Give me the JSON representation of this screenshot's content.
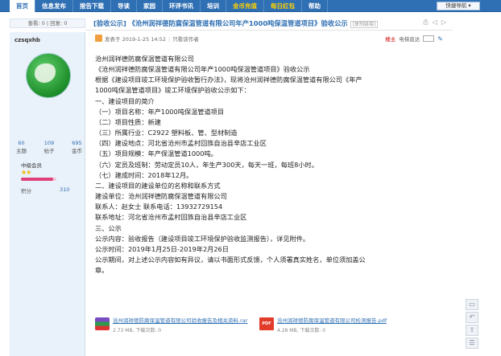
{
  "nav": {
    "items": [
      "首页",
      "信息发布",
      "报告下载",
      "导读",
      "家园",
      "环评书讯",
      "培训",
      "金币充值",
      "每日红包",
      "帮助"
    ],
    "quick_menu": "快捷导航 ▾"
  },
  "stats_bar": "查看: 0 | 回复: 0",
  "user": {
    "name": "czsqxhb",
    "stats": [
      {
        "value": "60",
        "label": "主题"
      },
      {
        "value": "109",
        "label": "帖子"
      },
      {
        "value": "695",
        "label": "金币"
      }
    ],
    "level": "中级会员",
    "stars": "★★",
    "score_label": "积分",
    "score_value": "310",
    "progress": 0.92
  },
  "post": {
    "title": "[验收公示] 《沧州润祥德防腐保温管道有限公司年产1000吨保温管道项目》验收公示",
    "copy_link": "[复制链接]",
    "posted": "发表于 2019-1-25 14:52",
    "only_author": "只看该作者",
    "floor": "楼主",
    "jump_label": "电梯直达",
    "body": [
      "沧州润祥德防腐保温管道有限公司",
      "《沧州润祥德防腐保温管道有限公司年产1000吨保温管道项目》验收公示",
      "根据《建设项目竣工环境保护验收暂行办法》，现将沧州润祥德防腐保温管道有限公司《年产",
      "1000吨保温管道项目》竣工环境保护验收公示如下：",
      "一、建设项目的简介",
      "（一）项目名称：年产1000吨保温管道项目",
      "（二）项目性质：新建",
      "（三）所属行业：C2922 塑料板、管、型材制造",
      "（四）建设地点：河北省沧州市孟村回族自治县辛店工业区",
      "（五）项目规模：年产保温管道1000吨。",
      "（六）定员及班制：劳动定员10人，年生产300天，每天一班，每班8小时。",
      "（七）建成时间：2018年12月。",
      "二、建设项目的建设单位的名称和联系方式",
      "建设单位：沧州润祥德防腐保温管道有限公司",
      "联系人：赵女士      联系电话：13932729154",
      "联系地址：河北省沧州市孟村回族自治县辛店工业区",
      "三、公示",
      "公示内容：验收报告（建设项目竣工环境保护验收监测报告），详见附件。",
      "公示时间：2019年1月25日-2019年2月26日",
      "公示期间，对上述公示内容如有异议，请以书面形式反馈，个人须署真实姓名，单位须加盖公",
      "章。"
    ]
  },
  "attachments": [
    {
      "name": "沧州润祥德防腐保温管道有限公司验收报告及相关资料.rar",
      "size": "2.73 MB, 下载次数: 0",
      "icon": "rar-icon"
    },
    {
      "name": "沧州润祥德防腐保温管道有限公司检测报告.pdf",
      "size": "4.28 MB, 下载次数: 0",
      "icon": "pdf-icon"
    }
  ],
  "float_tools": [
    "comment-icon",
    "back-icon",
    "top-icon",
    "list-icon"
  ]
}
